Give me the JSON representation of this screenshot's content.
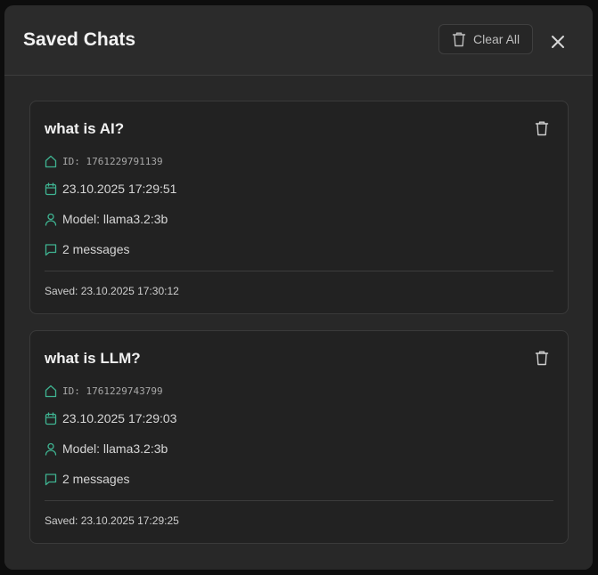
{
  "modal": {
    "title": "Saved Chats",
    "clear_all_label": "Clear All"
  },
  "colors": {
    "accent": "#3fb391",
    "background": "#2b2b2b",
    "card": "#222222"
  },
  "chats": [
    {
      "title": "what is AI?",
      "id": "ID: 1761229791139",
      "created": "23.10.2025 17:29:51",
      "model": "Model: llama3.2:3b",
      "messages": "2 messages",
      "saved": "Saved: 23.10.2025 17:30:12"
    },
    {
      "title": "what is LLM?",
      "id": "ID: 1761229743799",
      "created": "23.10.2025 17:29:03",
      "model": "Model: llama3.2:3b",
      "messages": "2 messages",
      "saved": "Saved: 23.10.2025 17:29:25"
    }
  ]
}
